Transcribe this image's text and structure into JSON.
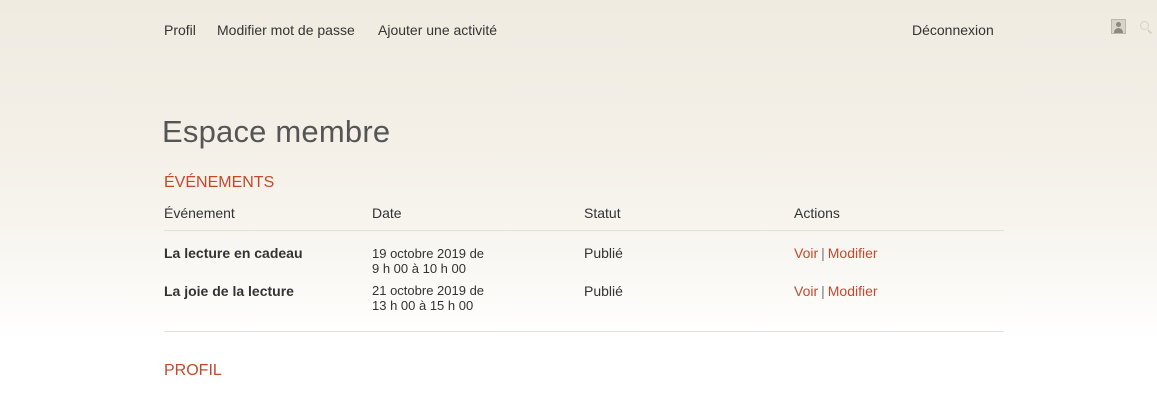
{
  "nav": {
    "profil": "Profil",
    "change_password": "Modifier mot de passe",
    "add_activity": "Ajouter une activité",
    "logout": "Déconnexion"
  },
  "page": {
    "title": "Espace membre"
  },
  "events": {
    "heading": "Événements",
    "columns": {
      "event": "Événement",
      "date": "Date",
      "status": "Statut",
      "actions": "Actions"
    },
    "rows": [
      {
        "name": "La lecture en cadeau",
        "date_line1": "19 octobre 2019 de",
        "date_line2": "9 h 00 à 10 h 00",
        "status": "Publié",
        "view": "Voir",
        "edit": "Modifier"
      },
      {
        "name": "La joie de la lecture",
        "date_line1": "21 octobre 2019 de",
        "date_line2": "13 h 00 à 15 h 00",
        "status": "Publié",
        "view": "Voir",
        "edit": "Modifier"
      }
    ],
    "separator": "|"
  },
  "profile": {
    "heading": "Profil"
  },
  "colors": {
    "accent": "#c3492d",
    "text": "#333333"
  }
}
